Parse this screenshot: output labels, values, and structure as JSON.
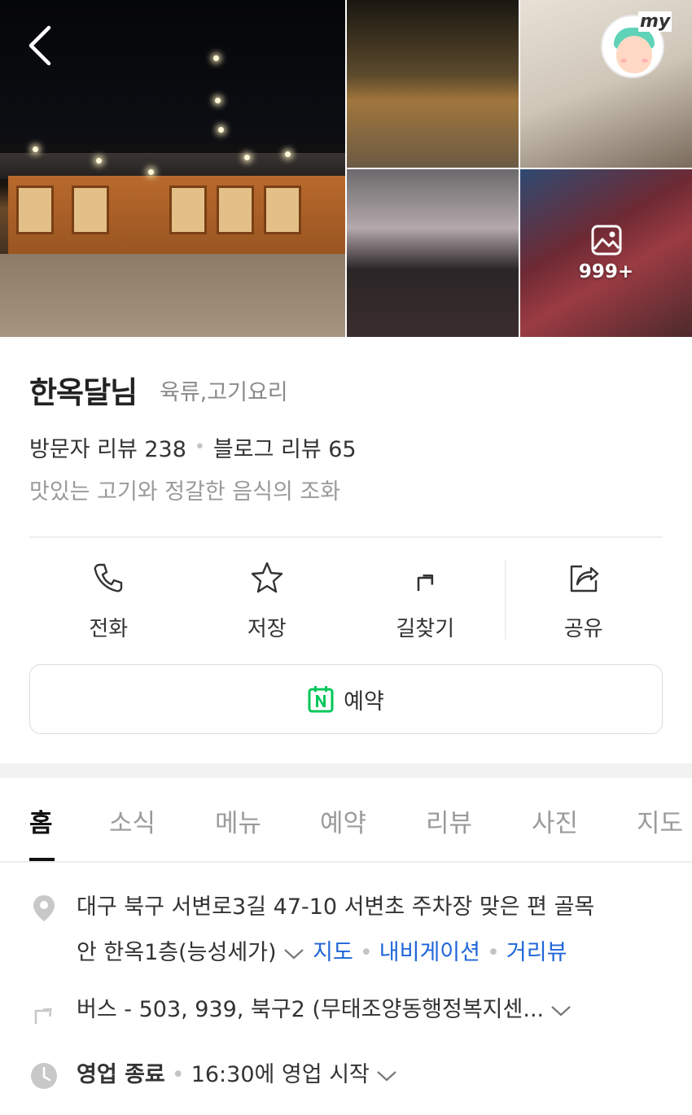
{
  "place": {
    "name": "한옥달님",
    "category": "육류,고기요리",
    "visitor_reviews": "방문자 리뷰 238",
    "blog_reviews": "블로그 리뷰 65",
    "tagline": "맛있는 고기와 정갈한 음식의 조화"
  },
  "photos": {
    "more_count": "999+",
    "my_badge": "my"
  },
  "actions": {
    "call": "전화",
    "save": "저장",
    "directions": "길찾기",
    "share": "공유",
    "reserve": "예약"
  },
  "tabs": [
    "홈",
    "소식",
    "메뉴",
    "예약",
    "리뷰",
    "사진",
    "지도"
  ],
  "info": {
    "address_line1": "대구 북구 서변로3길 47-10 서변초 주차장 맞은 편 골목",
    "address_line2": "안 한옥1층(능성세가)",
    "map_link": "지도",
    "navigation_link": "내비게이션",
    "street_view_link": "거리뷰",
    "transit": "버스 - 503, 939, 북구2 (무태조양동행정복지센...",
    "hours_status": "영업 종료",
    "hours_detail": "16:30에 영업 시작"
  },
  "colors": {
    "link_blue": "#1f66d8",
    "reserve_green": "#03c75a"
  }
}
